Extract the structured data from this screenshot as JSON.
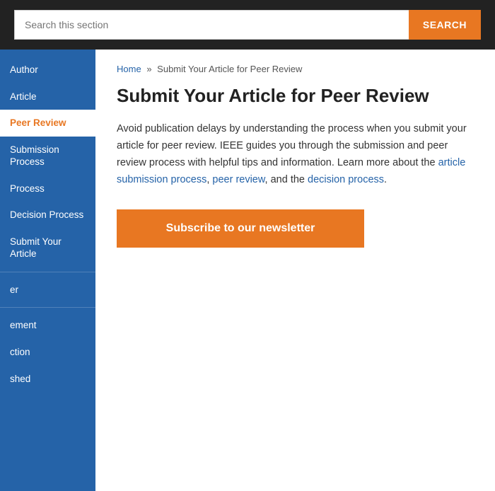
{
  "header": {
    "search_placeholder": "Search this section",
    "search_button_label": "SEARCH"
  },
  "sidebar": {
    "items": [
      {
        "id": "author",
        "label": "Author",
        "active": false,
        "sub": false
      },
      {
        "id": "article",
        "label": "Article",
        "active": false,
        "sub": false
      },
      {
        "id": "peer-review",
        "label": "Peer Review",
        "active": true,
        "sub": false
      },
      {
        "id": "submission-process",
        "label": "Submission Process",
        "active": false,
        "sub": true
      },
      {
        "id": "process",
        "label": "Process",
        "active": false,
        "sub": true
      },
      {
        "id": "decision-process",
        "label": "Decision Process",
        "active": false,
        "sub": true
      },
      {
        "id": "submit-your-article",
        "label": "Submit Your Article",
        "active": false,
        "sub": true
      },
      {
        "id": "er",
        "label": "er",
        "active": false,
        "sub": false
      },
      {
        "id": "ement",
        "label": "ement",
        "active": false,
        "sub": false
      },
      {
        "id": "ction",
        "label": "ction",
        "active": false,
        "sub": false
      },
      {
        "id": "shed",
        "label": "shed",
        "active": false,
        "sub": false
      }
    ]
  },
  "breadcrumb": {
    "home_label": "Home",
    "separator": "»",
    "current_label": "Submit Your Article for Peer Review"
  },
  "main": {
    "title": "Submit Your Article for Peer Review",
    "body_text": "Avoid publication delays by understanding the process when you submit your article for peer review. IEEE guides you through the submission and peer review process with helpful tips and information. Learn more about the ",
    "body_link1": "article submission process",
    "body_middle": ", ",
    "body_link2": "peer review",
    "body_and": ", and the ",
    "body_link3": "decision process",
    "body_end": "."
  },
  "newsletter": {
    "button_label": "Subscribe to our newsletter"
  }
}
